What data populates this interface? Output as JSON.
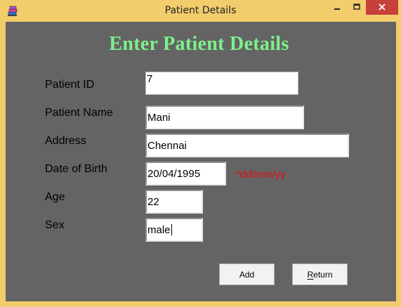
{
  "window": {
    "title": "Patient Details",
    "app_icon": "books-icon",
    "controls": {
      "minimize": "minimize-icon",
      "maximize": "maximize-icon",
      "close": "close-icon"
    }
  },
  "form": {
    "heading": "Enter Patient  Details",
    "fields": {
      "patient_id": {
        "label": "Patient ID",
        "value": "7"
      },
      "patient_name": {
        "label": "Patient Name",
        "value": "Mani"
      },
      "address": {
        "label": "Address",
        "value": "Chennai"
      },
      "dob": {
        "label": "Date of Birth",
        "value": "20/04/1995",
        "hint": "*dd/mm/yy"
      },
      "age": {
        "label": "Age",
        "value": "22"
      },
      "sex": {
        "label": "Sex",
        "value": "male"
      }
    },
    "buttons": {
      "add": "Add",
      "return": "Return"
    }
  },
  "colors": {
    "window_frame": "#f3cd6c",
    "client_bg": "#646464",
    "heading": "#7ef08a",
    "hint": "#e01010",
    "close_button": "#c7403a"
  }
}
